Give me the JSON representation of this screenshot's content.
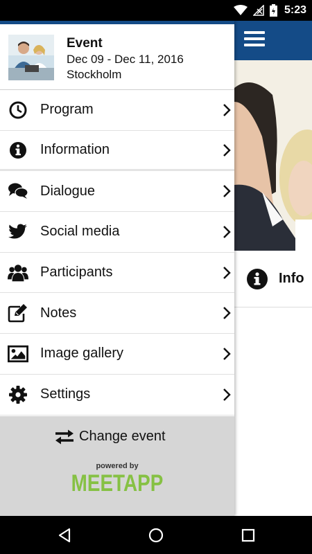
{
  "status_bar": {
    "time": "5:23"
  },
  "drawer": {
    "event": {
      "title": "Event",
      "dates": "Dec 09 - Dec 11, 2016",
      "location": "Stockholm"
    },
    "menu": [
      {
        "label": "Program",
        "icon": "clock-icon"
      },
      {
        "label": "Information",
        "icon": "info-icon"
      },
      {
        "label": "Dialogue",
        "icon": "chat-bubbles-icon"
      },
      {
        "label": "Social media",
        "icon": "twitter-icon"
      },
      {
        "label": "Participants",
        "icon": "people-icon"
      },
      {
        "label": "Notes",
        "icon": "edit-icon"
      },
      {
        "label": "Image gallery",
        "icon": "image-icon"
      },
      {
        "label": "Settings",
        "icon": "gear-icon"
      }
    ],
    "footer": {
      "change_event": "Change event",
      "powered_by": "powered by",
      "brand": "MEETAPP"
    }
  },
  "background_content": {
    "info_label": "Info"
  },
  "colors": {
    "toolbar": "#144b87",
    "brand_green": "#86c144",
    "footer_bg": "#d6d6d6"
  }
}
